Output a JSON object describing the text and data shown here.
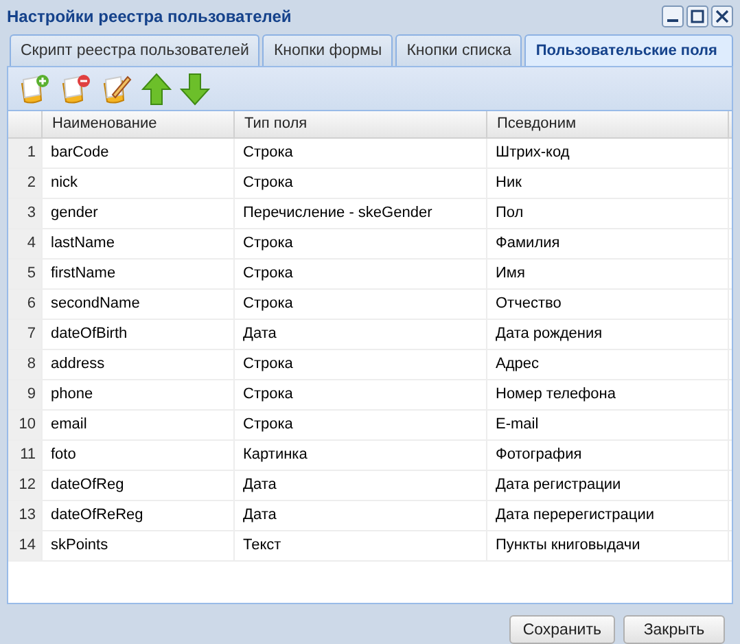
{
  "window": {
    "title": "Настройки реестра пользователей"
  },
  "tabs": [
    {
      "label": "Скрипт реестра пользователей",
      "selected": false
    },
    {
      "label": "Кнопки формы",
      "selected": false
    },
    {
      "label": "Кнопки списка",
      "selected": false
    },
    {
      "label": "Пользовательские поля",
      "selected": true
    }
  ],
  "toolbar": [
    {
      "kind": "add"
    },
    {
      "kind": "remove"
    },
    {
      "kind": "edit"
    },
    {
      "kind": "up"
    },
    {
      "kind": "down"
    }
  ],
  "table": {
    "columns": [
      "",
      "Наименование",
      "Тип поля",
      "Псевдоним"
    ],
    "rows": [
      [
        "1",
        "barCode",
        "Строка",
        "Штрих-код"
      ],
      [
        "2",
        "nick",
        "Строка",
        "Ник"
      ],
      [
        "3",
        "gender",
        "Перечисление - skeGender",
        "Пол"
      ],
      [
        "4",
        "lastName",
        "Строка",
        "Фамилия"
      ],
      [
        "5",
        "firstName",
        "Строка",
        "Имя"
      ],
      [
        "6",
        "secondName",
        "Строка",
        "Отчество"
      ],
      [
        "7",
        "dateOfBirth",
        "Дата",
        "Дата рождения"
      ],
      [
        "8",
        "address",
        "Строка",
        "Адрес"
      ],
      [
        "9",
        "phone",
        "Строка",
        "Номер телефона"
      ],
      [
        "10",
        "email",
        "Строка",
        "E-mail"
      ],
      [
        "11",
        "foto",
        "Картинка",
        "Фотография"
      ],
      [
        "12",
        "dateOfReg",
        "Дата",
        "Дата регистрации"
      ],
      [
        "13",
        "dateOfReReg",
        "Дата",
        "Дата перерегистрации"
      ],
      [
        "14",
        "skPoints",
        "Текст",
        "Пункты книговыдачи"
      ]
    ]
  },
  "buttons": [
    "Сохранить",
    "Закрыть"
  ]
}
